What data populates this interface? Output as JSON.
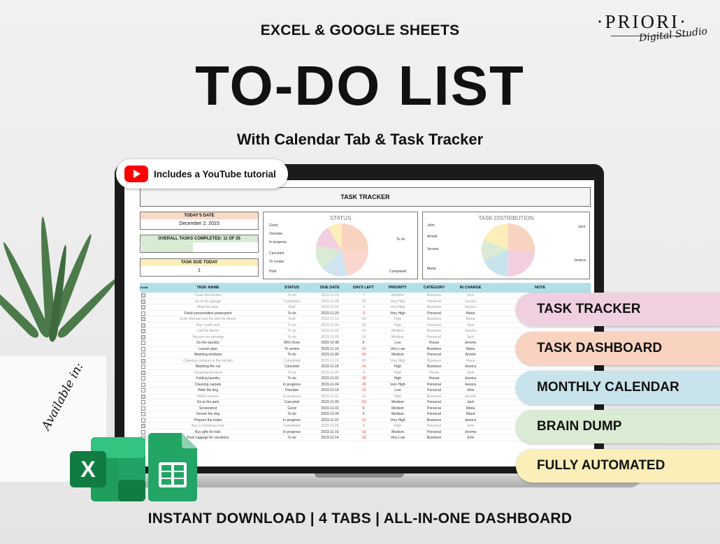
{
  "header": {
    "top": "EXCEL & GOOGLE SHEETS",
    "main": "TO-DO LIST",
    "sub": "With Calendar Tab & Task Tracker"
  },
  "logo": {
    "name": "·PRIORI·",
    "script": "Digital Studio"
  },
  "youtube": {
    "label": "Includes a YouTube tutorial"
  },
  "sheet": {
    "title": "TASK TRACKER",
    "today_label": "TODAY'S DATE",
    "today_value": "December 2, 2023",
    "completed_label": "OVERALL TASKS COMPLETED: 11 OF 25",
    "due_label": "TASK DUE TODAY",
    "due_value": "1",
    "status_title": "STATUS",
    "status_labels": [
      "Good",
      "Overdue",
      "In progress",
      "Canceled",
      "To review",
      "Hold",
      "To do",
      "Completed"
    ],
    "distribution_title": "TASK DISTRIBUTION",
    "distribution_labels": [
      "John",
      "Arnold",
      "Jerome",
      "Maria",
      "Jack",
      "Jessica"
    ],
    "columns": [
      "DONE",
      "TASK NAME",
      "STATUS",
      "DUE DATE",
      "DAYS LEFT",
      "PRIORITY",
      "CATEGORY",
      "IN CHARGE",
      "NOTE"
    ],
    "rows": [
      {
        "done": true,
        "task": "Clean the kitchen",
        "status": "To do",
        "due": "2023-11-29",
        "days": "-7",
        "priority": "Medium",
        "category": "Business",
        "charge": "Jack"
      },
      {
        "done": true,
        "task": "Go to the garage",
        "status": "Completed",
        "due": "2023-11-28",
        "days": "-19",
        "priority": "Very High",
        "category": "Personal",
        "charge": "Jessica"
      },
      {
        "done": true,
        "task": "Mow the lawn",
        "status": "Hold",
        "due": "2023-11-20",
        "days": "-3",
        "priority": "Very High",
        "category": "Business",
        "charge": "Jessica"
      },
      {
        "done": false,
        "task": "Finish presentation powerpoint",
        "status": "To do",
        "due": "2023-11-29",
        "days": "-3",
        "priority": "Very High",
        "category": "Personal",
        "charge": "Maria"
      },
      {
        "done": true,
        "task": "Invite Michael and his wife for dinner",
        "status": "Hold",
        "due": "2023-11-10",
        "days": "-22",
        "priority": "High",
        "category": "Business",
        "charge": "Maria"
      },
      {
        "done": true,
        "task": "Pay credit card",
        "status": "To do",
        "due": "2023-11-04",
        "days": "-28",
        "priority": "High",
        "category": "Personal",
        "charge": "Jack"
      },
      {
        "done": true,
        "task": "Call the doctor",
        "status": "To do",
        "due": "2023-11-05",
        "days": "-14",
        "priority": "Medium",
        "category": "Business",
        "charge": "Jessica"
      },
      {
        "done": true,
        "task": "Vacuum on saturday",
        "status": "To do",
        "due": "2023-11-05",
        "days": "-14",
        "priority": "Medium",
        "category": "Personal",
        "charge": "Jack"
      },
      {
        "done": false,
        "task": "Do the laundry",
        "status": "99% Done",
        "due": "2023-12-08",
        "days": "6",
        "priority": "Low",
        "category": "House",
        "charge": "Jerome"
      },
      {
        "done": false,
        "task": "Lesson plan",
        "status": "To review",
        "due": "2023-11-16",
        "days": "-16",
        "priority": "Very Low",
        "category": "Business",
        "charge": "Maria"
      },
      {
        "done": false,
        "task": "Washing windows",
        "status": "To do",
        "due": "2023-11-06",
        "days": "-26",
        "priority": "Medium",
        "category": "Personal",
        "charge": "Arnold"
      },
      {
        "done": true,
        "task": "Cleaning surfaces in the kitchen",
        "status": "Completed",
        "due": "2023-11-12",
        "days": "-20",
        "priority": "Very High",
        "category": "Business",
        "charge": "Maria"
      },
      {
        "done": false,
        "task": "Washing the car",
        "status": "Canceled",
        "due": "2023-11-18",
        "days": "-14",
        "priority": "High",
        "category": "Business",
        "charge": "Jessica"
      },
      {
        "done": true,
        "task": "Cleaning furniture",
        "status": "To do",
        "due": "2023-11-26",
        "days": "-6",
        "priority": "High",
        "category": "House",
        "charge": "Jack"
      },
      {
        "done": false,
        "task": "Folding laundry",
        "status": "To do",
        "due": "2023-11-02",
        "days": "-30",
        "priority": "High",
        "category": "House",
        "charge": "Jessica"
      },
      {
        "done": false,
        "task": "Cleaning carpets",
        "status": "In progress",
        "due": "2023-11-04",
        "days": "-28",
        "priority": "Very High",
        "category": "Personal",
        "charge": "Jessica"
      },
      {
        "done": false,
        "task": "Walk the dog",
        "status": "Overdue",
        "due": "2023-11-10",
        "days": "-22",
        "priority": "Low",
        "category": "Personal",
        "charge": "John"
      },
      {
        "done": true,
        "task": "Watch movies",
        "status": "In progress",
        "due": "2023-11-01",
        "days": "-31",
        "priority": "High",
        "category": "Business",
        "charge": "Jerome"
      },
      {
        "done": false,
        "task": "Go to the park",
        "status": "Canceled",
        "due": "2023-11-09",
        "days": "-23",
        "priority": "Medium",
        "category": "Personal",
        "charge": "Jack"
      },
      {
        "done": false,
        "task": "Screenshot",
        "status": "Good",
        "due": "2023-12-02",
        "days": "0",
        "priority": "Medium",
        "category": "Personal",
        "charge": "Maria"
      },
      {
        "done": false,
        "task": "Groom the dog",
        "status": "To do",
        "due": "2023-12-04",
        "days": "2",
        "priority": "Medium",
        "category": "Personal",
        "charge": "Maria"
      },
      {
        "done": false,
        "task": "Prepare the trailer",
        "status": "In progress",
        "due": "2023-11-22",
        "days": "-10",
        "priority": "Very High",
        "category": "Business",
        "charge": "Jessica"
      },
      {
        "done": true,
        "task": "Buy a Christmas tree",
        "status": "Completed",
        "due": "2023-11-26",
        "days": "-6",
        "priority": "High",
        "category": "Personal",
        "charge": "John"
      },
      {
        "done": false,
        "task": "Buy gifts for kids",
        "status": "In progress",
        "due": "2023-11-16",
        "days": "-16",
        "priority": "Medium",
        "category": "Personal",
        "charge": "Jerome"
      },
      {
        "done": false,
        "task": "Pack luggage for vacations",
        "status": "To do",
        "due": "2023-11-14",
        "days": "-18",
        "priority": "Very Low",
        "category": "Business",
        "charge": "John"
      }
    ]
  },
  "pills": [
    {
      "label": "TASK TRACKER",
      "color": "#f0cfe0"
    },
    {
      "label": "TASK DASHBOARD",
      "color": "#f8d3bf"
    },
    {
      "label": "MONTHLY CALENDAR",
      "color": "#c9e3ec"
    },
    {
      "label": "BRAIN DUMP",
      "color": "#d9ebd2"
    },
    {
      "label": "FULLY AUTOMATED",
      "color": "#fbeeb9"
    }
  ],
  "available": "Available in:",
  "footer": "INSTANT DOWNLOAD  |  4 TABS  |  ALL-IN-ONE DASHBOARD",
  "app_icons": [
    "excel-icon",
    "google-sheets-icon"
  ]
}
